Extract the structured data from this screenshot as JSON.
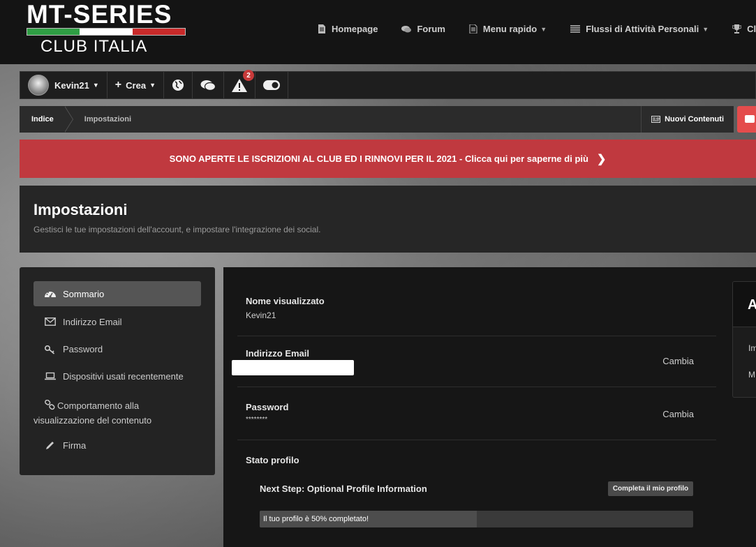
{
  "logo": {
    "line1": "MT-SERIES",
    "line2": "CLUB ITALIA",
    "flag_colors": [
      "#2f9e44",
      "#ffffff",
      "#c92a2a"
    ]
  },
  "nav": [
    {
      "label": "Homepage",
      "icon": "document-icon",
      "caret": false
    },
    {
      "label": "Forum",
      "icon": "chat-icon",
      "caret": false
    },
    {
      "label": "Menu rapido",
      "icon": "document-lines-icon",
      "caret": true
    },
    {
      "label": "Flussi di Attività Personali",
      "icon": "list-icon",
      "caret": true
    },
    {
      "label": "Classifi",
      "icon": "trophy-icon",
      "caret": false
    }
  ],
  "userbar": {
    "username": "Kevin21",
    "create_label": "Crea",
    "notifications_count": "2"
  },
  "breadcrumb": {
    "items": [
      "Indice",
      "Impostazioni"
    ],
    "new_content": "Nuovi Contenuti"
  },
  "announcement": {
    "text": "SONO APERTE LE ISCRIZIONI AL CLUB ED I RINNOVI PER IL 2021 - Clicca qui per saperne di più",
    "color": "#c0393f"
  },
  "page": {
    "title": "Impostazioni",
    "subtitle": "Gestisci le tue impostazioni dell'account, e impostare l'integrazione dei social."
  },
  "sidebar": {
    "items": [
      {
        "label": "Sommario",
        "icon": "dashboard-icon",
        "active": true
      },
      {
        "label": "Indirizzo Email",
        "icon": "envelope-icon",
        "active": false
      },
      {
        "label": "Password",
        "icon": "key-icon",
        "active": false
      },
      {
        "label": "Dispositivi usati recentemente",
        "icon": "laptop-icon",
        "active": false
      },
      {
        "label": "Comportamento alla visualizzazione del contenuto",
        "icon": "link-icon",
        "active": false
      },
      {
        "label": "Firma",
        "icon": "pencil-icon",
        "active": false
      }
    ]
  },
  "settings": {
    "display_name": {
      "label": "Nome visualizzato",
      "value": "Kevin21"
    },
    "email": {
      "label": "Indirizzo Email",
      "action": "Cambia"
    },
    "password": {
      "label": "Password",
      "value": "********",
      "action": "Cambia"
    },
    "profile_status": {
      "label": "Stato profilo",
      "next_step": "Next Step: Optional Profile Information",
      "complete_button": "Completa il mio profilo",
      "progress_text": "Il tuo profilo è 50% completato!",
      "progress_fraction": 0.5
    }
  },
  "right_card": {
    "head": "A",
    "line1": "Im",
    "line2": "M"
  }
}
